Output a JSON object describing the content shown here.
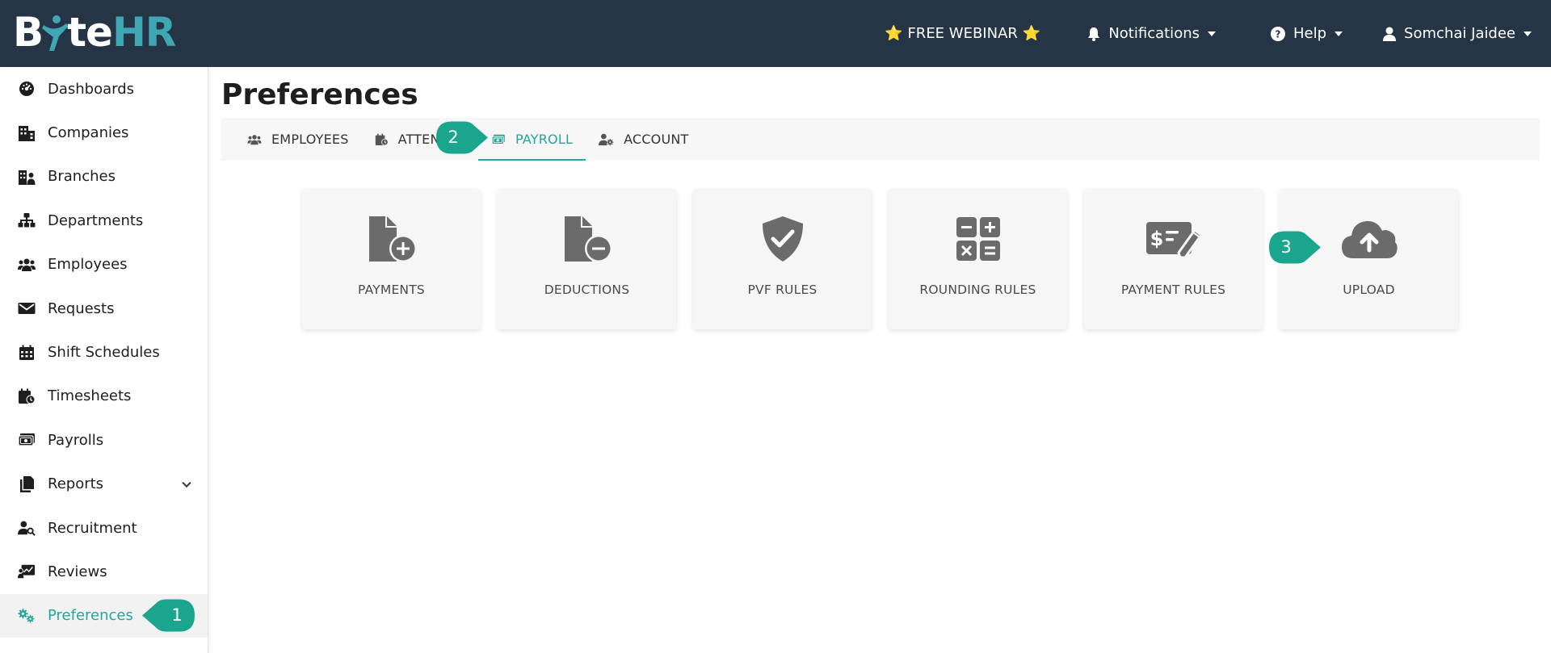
{
  "header": {
    "logo_text": [
      "B",
      "te",
      "HR"
    ],
    "webinar_label": "FREE WEBINAR",
    "webinar_star": "⭐",
    "notifications_label": "Notifications",
    "help_label": "Help",
    "user_name": "Somchai Jaidee"
  },
  "sidebar": {
    "items": [
      {
        "label": "Dashboards",
        "icon": "gauge-icon"
      },
      {
        "label": "Companies",
        "icon": "building-icon"
      },
      {
        "label": "Branches",
        "icon": "branches-icon"
      },
      {
        "label": "Departments",
        "icon": "sitemap-icon"
      },
      {
        "label": "Employees",
        "icon": "users-icon"
      },
      {
        "label": "Requests",
        "icon": "envelope-icon"
      },
      {
        "label": "Shift Schedules",
        "icon": "calendar-icon"
      },
      {
        "label": "Timesheets",
        "icon": "calendar-clock-icon"
      },
      {
        "label": "Payrolls",
        "icon": "money-icon"
      },
      {
        "label": "Reports",
        "icon": "copy-icon"
      },
      {
        "label": "Recruitment",
        "icon": "user-search-icon"
      },
      {
        "label": "Reviews",
        "icon": "chart-board-icon"
      },
      {
        "label": "Preferences",
        "icon": "gears-icon"
      }
    ],
    "active_index": 12
  },
  "page": {
    "title": "Preferences"
  },
  "tabs": [
    {
      "label": "EMPLOYEES",
      "icon": "users-icon"
    },
    {
      "label": "ATTENDA",
      "icon": "calendar-clock-icon"
    },
    {
      "label": "PAYROLL",
      "icon": "money-icon"
    },
    {
      "label": "ACCOUNT",
      "icon": "user-gear-icon"
    }
  ],
  "active_tab": "PAYROLL",
  "cards": [
    {
      "label": "PAYMENTS",
      "icon": "file-plus-icon"
    },
    {
      "label": "DEDUCTIONS",
      "icon": "file-minus-icon"
    },
    {
      "label": "PVF RULES",
      "icon": "shield-check-icon"
    },
    {
      "label": "ROUNDING RULES",
      "icon": "calculator-icon"
    },
    {
      "label": "PAYMENT RULES",
      "icon": "money-check-pen-icon"
    },
    {
      "label": "UPLOAD",
      "icon": "cloud-upload-icon"
    }
  ],
  "callouts": [
    "1",
    "2",
    "3"
  ],
  "colors": {
    "topbar": "#263545",
    "accent": "#25a69a",
    "callout": "#1aa58e",
    "logo_accent": "#3fa6b3"
  }
}
